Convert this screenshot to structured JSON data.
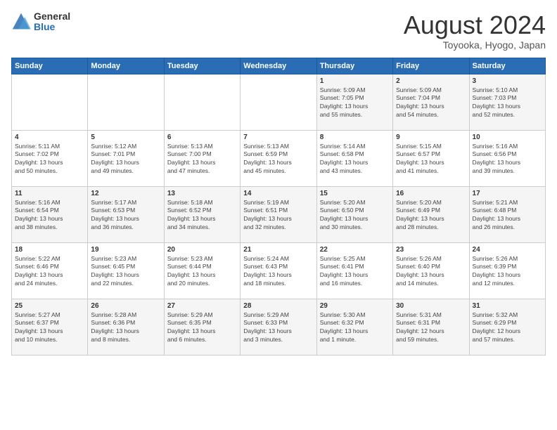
{
  "logo": {
    "general": "General",
    "blue": "Blue"
  },
  "title": "August 2024",
  "subtitle": "Toyooka, Hyogo, Japan",
  "weekdays": [
    "Sunday",
    "Monday",
    "Tuesday",
    "Wednesday",
    "Thursday",
    "Friday",
    "Saturday"
  ],
  "weeks": [
    [
      {
        "day": "",
        "info": ""
      },
      {
        "day": "",
        "info": ""
      },
      {
        "day": "",
        "info": ""
      },
      {
        "day": "",
        "info": ""
      },
      {
        "day": "1",
        "info": "Sunrise: 5:09 AM\nSunset: 7:05 PM\nDaylight: 13 hours\nand 55 minutes."
      },
      {
        "day": "2",
        "info": "Sunrise: 5:09 AM\nSunset: 7:04 PM\nDaylight: 13 hours\nand 54 minutes."
      },
      {
        "day": "3",
        "info": "Sunrise: 5:10 AM\nSunset: 7:03 PM\nDaylight: 13 hours\nand 52 minutes."
      }
    ],
    [
      {
        "day": "4",
        "info": "Sunrise: 5:11 AM\nSunset: 7:02 PM\nDaylight: 13 hours\nand 50 minutes."
      },
      {
        "day": "5",
        "info": "Sunrise: 5:12 AM\nSunset: 7:01 PM\nDaylight: 13 hours\nand 49 minutes."
      },
      {
        "day": "6",
        "info": "Sunrise: 5:13 AM\nSunset: 7:00 PM\nDaylight: 13 hours\nand 47 minutes."
      },
      {
        "day": "7",
        "info": "Sunrise: 5:13 AM\nSunset: 6:59 PM\nDaylight: 13 hours\nand 45 minutes."
      },
      {
        "day": "8",
        "info": "Sunrise: 5:14 AM\nSunset: 6:58 PM\nDaylight: 13 hours\nand 43 minutes."
      },
      {
        "day": "9",
        "info": "Sunrise: 5:15 AM\nSunset: 6:57 PM\nDaylight: 13 hours\nand 41 minutes."
      },
      {
        "day": "10",
        "info": "Sunrise: 5:16 AM\nSunset: 6:56 PM\nDaylight: 13 hours\nand 39 minutes."
      }
    ],
    [
      {
        "day": "11",
        "info": "Sunrise: 5:16 AM\nSunset: 6:54 PM\nDaylight: 13 hours\nand 38 minutes."
      },
      {
        "day": "12",
        "info": "Sunrise: 5:17 AM\nSunset: 6:53 PM\nDaylight: 13 hours\nand 36 minutes."
      },
      {
        "day": "13",
        "info": "Sunrise: 5:18 AM\nSunset: 6:52 PM\nDaylight: 13 hours\nand 34 minutes."
      },
      {
        "day": "14",
        "info": "Sunrise: 5:19 AM\nSunset: 6:51 PM\nDaylight: 13 hours\nand 32 minutes."
      },
      {
        "day": "15",
        "info": "Sunrise: 5:20 AM\nSunset: 6:50 PM\nDaylight: 13 hours\nand 30 minutes."
      },
      {
        "day": "16",
        "info": "Sunrise: 5:20 AM\nSunset: 6:49 PM\nDaylight: 13 hours\nand 28 minutes."
      },
      {
        "day": "17",
        "info": "Sunrise: 5:21 AM\nSunset: 6:48 PM\nDaylight: 13 hours\nand 26 minutes."
      }
    ],
    [
      {
        "day": "18",
        "info": "Sunrise: 5:22 AM\nSunset: 6:46 PM\nDaylight: 13 hours\nand 24 minutes."
      },
      {
        "day": "19",
        "info": "Sunrise: 5:23 AM\nSunset: 6:45 PM\nDaylight: 13 hours\nand 22 minutes."
      },
      {
        "day": "20",
        "info": "Sunrise: 5:23 AM\nSunset: 6:44 PM\nDaylight: 13 hours\nand 20 minutes."
      },
      {
        "day": "21",
        "info": "Sunrise: 5:24 AM\nSunset: 6:43 PM\nDaylight: 13 hours\nand 18 minutes."
      },
      {
        "day": "22",
        "info": "Sunrise: 5:25 AM\nSunset: 6:41 PM\nDaylight: 13 hours\nand 16 minutes."
      },
      {
        "day": "23",
        "info": "Sunrise: 5:26 AM\nSunset: 6:40 PM\nDaylight: 13 hours\nand 14 minutes."
      },
      {
        "day": "24",
        "info": "Sunrise: 5:26 AM\nSunset: 6:39 PM\nDaylight: 13 hours\nand 12 minutes."
      }
    ],
    [
      {
        "day": "25",
        "info": "Sunrise: 5:27 AM\nSunset: 6:37 PM\nDaylight: 13 hours\nand 10 minutes."
      },
      {
        "day": "26",
        "info": "Sunrise: 5:28 AM\nSunset: 6:36 PM\nDaylight: 13 hours\nand 8 minutes."
      },
      {
        "day": "27",
        "info": "Sunrise: 5:29 AM\nSunset: 6:35 PM\nDaylight: 13 hours\nand 6 minutes."
      },
      {
        "day": "28",
        "info": "Sunrise: 5:29 AM\nSunset: 6:33 PM\nDaylight: 13 hours\nand 3 minutes."
      },
      {
        "day": "29",
        "info": "Sunrise: 5:30 AM\nSunset: 6:32 PM\nDaylight: 13 hours\nand 1 minute."
      },
      {
        "day": "30",
        "info": "Sunrise: 5:31 AM\nSunset: 6:31 PM\nDaylight: 12 hours\nand 59 minutes."
      },
      {
        "day": "31",
        "info": "Sunrise: 5:32 AM\nSunset: 6:29 PM\nDaylight: 12 hours\nand 57 minutes."
      }
    ]
  ]
}
